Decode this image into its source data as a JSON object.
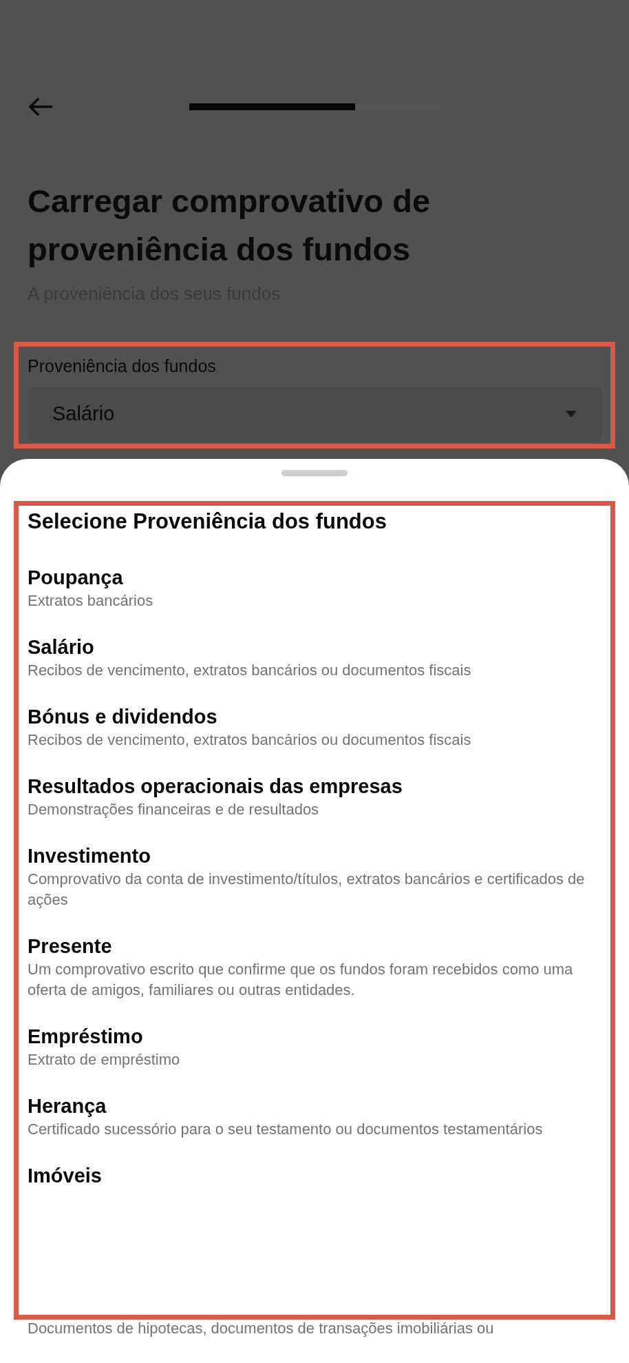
{
  "header": {
    "progress": {
      "level": 0.66
    }
  },
  "title": "Carregar comprovativo de proveniência dos fundos",
  "subtitle": "A proveniência dos seus fundos",
  "field": {
    "label": "Proveniência dos fundos",
    "value": "Salário"
  },
  "sheet": {
    "title": "Selecione Proveniência dos fundos",
    "options": [
      {
        "title": "Poupança",
        "description": "Extratos bancários"
      },
      {
        "title": "Salário",
        "description": "Recibos de vencimento, extratos bancários ou documentos fiscais"
      },
      {
        "title": "Bónus e dividendos",
        "description": "Recibos de vencimento, extratos bancários ou documentos fiscais"
      },
      {
        "title": "Resultados operacionais das empresas",
        "description": "Demonstrações financeiras e de resultados"
      },
      {
        "title": "Investimento",
        "description": "Comprovativo da conta de investimento/títulos, extratos bancários e certificados de ações"
      },
      {
        "title": "Presente",
        "description": "Um comprovativo escrito que confirme que os fundos foram recebidos como uma oferta de amigos, familiares ou outras entidades."
      },
      {
        "title": "Empréstimo",
        "description": "Extrato de empréstimo"
      },
      {
        "title": "Herança",
        "description": "Certificado sucessório para o seu testamento ou documentos testamentários"
      },
      {
        "title": "Imóveis"
      }
    ],
    "trailing_text": "Documentos de hipotecas, documentos de transações imobiliárias ou"
  }
}
